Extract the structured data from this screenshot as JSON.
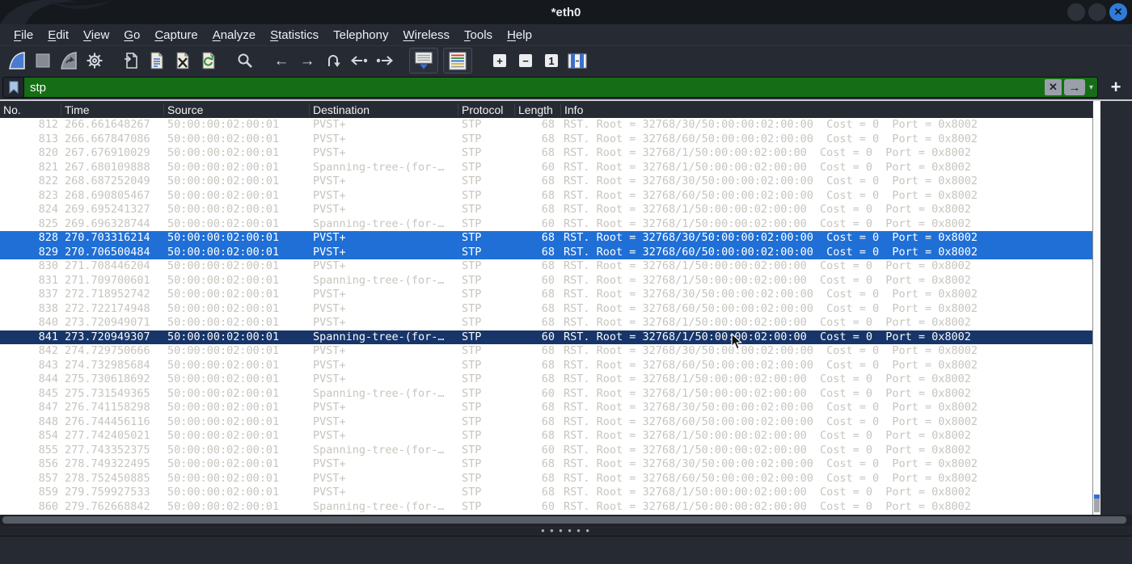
{
  "window": {
    "title": "*eth0",
    "controls": [
      "minimize",
      "maximize",
      "close"
    ],
    "close_glyph": "✕"
  },
  "menu_bar": {
    "items": [
      {
        "label": "File",
        "mnemonic": "F"
      },
      {
        "label": "Edit",
        "mnemonic": "E"
      },
      {
        "label": "View",
        "mnemonic": "V"
      },
      {
        "label": "Go",
        "mnemonic": "G"
      },
      {
        "label": "Capture",
        "mnemonic": "C"
      },
      {
        "label": "Analyze",
        "mnemonic": "A"
      },
      {
        "label": "Statistics",
        "mnemonic": "S"
      },
      {
        "label": "Telephony",
        "mnemonic": null
      },
      {
        "label": "Wireless",
        "mnemonic": "W"
      },
      {
        "label": "Tools",
        "mnemonic": "T"
      },
      {
        "label": "Help",
        "mnemonic": "H"
      }
    ]
  },
  "toolbar": {
    "buttons": [
      "start-capture",
      "stop-capture",
      "restart-capture",
      "capture-options",
      "open-file",
      "save-file",
      "close-file",
      "reload-file",
      "find-packet",
      "go-back",
      "go-forward",
      "go-to-packet",
      "go-first-packet",
      "go-last-packet",
      "auto-scroll-toggle",
      "colorize-toggle",
      "zoom-in",
      "zoom-out",
      "normal-size",
      "resize-columns"
    ]
  },
  "filter_bar": {
    "value": "stp",
    "clear_glyph": "✕",
    "apply_glyph": "→",
    "dropdown_glyph": "▾",
    "add_glyph": "+"
  },
  "packet_list": {
    "columns": [
      "No.",
      "Time",
      "Source",
      "Destination",
      "Protocol",
      "Length",
      "Info"
    ],
    "rows": [
      {
        "no": "812",
        "time": "266.661648267",
        "source": "50:00:00:02:00:01",
        "destination": "PVST+",
        "protocol": "STP",
        "length": "68",
        "info": "RST. Root = 32768/30/50:00:00:02:00:00  Cost = 0  Port = 0x8002",
        "selected": "none"
      },
      {
        "no": "813",
        "time": "266.667847086",
        "source": "50:00:00:02:00:01",
        "destination": "PVST+",
        "protocol": "STP",
        "length": "68",
        "info": "RST. Root = 32768/60/50:00:00:02:00:00  Cost = 0  Port = 0x8002",
        "selected": "none"
      },
      {
        "no": "820",
        "time": "267.676910029",
        "source": "50:00:00:02:00:01",
        "destination": "PVST+",
        "protocol": "STP",
        "length": "68",
        "info": "RST. Root = 32768/1/50:00:00:02:00:00  Cost = 0  Port = 0x8002",
        "selected": "none"
      },
      {
        "no": "821",
        "time": "267.680109888",
        "source": "50:00:00:02:00:01",
        "destination": "Spanning-tree-(for-…",
        "protocol": "STP",
        "length": "60",
        "info": "RST. Root = 32768/1/50:00:00:02:00:00  Cost = 0  Port = 0x8002",
        "selected": "none"
      },
      {
        "no": "822",
        "time": "268.687252049",
        "source": "50:00:00:02:00:01",
        "destination": "PVST+",
        "protocol": "STP",
        "length": "68",
        "info": "RST. Root = 32768/30/50:00:00:02:00:00  Cost = 0  Port = 0x8002",
        "selected": "none"
      },
      {
        "no": "823",
        "time": "268.690805467",
        "source": "50:00:00:02:00:01",
        "destination": "PVST+",
        "protocol": "STP",
        "length": "68",
        "info": "RST. Root = 32768/60/50:00:00:02:00:00  Cost = 0  Port = 0x8002",
        "selected": "none"
      },
      {
        "no": "824",
        "time": "269.695241327",
        "source": "50:00:00:02:00:01",
        "destination": "PVST+",
        "protocol": "STP",
        "length": "68",
        "info": "RST. Root = 32768/1/50:00:00:02:00:00  Cost = 0  Port = 0x8002",
        "selected": "none"
      },
      {
        "no": "825",
        "time": "269.696328744",
        "source": "50:00:00:02:00:01",
        "destination": "Spanning-tree-(for-…",
        "protocol": "STP",
        "length": "60",
        "info": "RST. Root = 32768/1/50:00:00:02:00:00  Cost = 0  Port = 0x8002",
        "selected": "none"
      },
      {
        "no": "828",
        "time": "270.703316214",
        "source": "50:00:00:02:00:01",
        "destination": "PVST+",
        "protocol": "STP",
        "length": "68",
        "info": "RST. Root = 32768/30/50:00:00:02:00:00  Cost = 0  Port = 0x8002",
        "selected": "light"
      },
      {
        "no": "829",
        "time": "270.706500484",
        "source": "50:00:00:02:00:01",
        "destination": "PVST+",
        "protocol": "STP",
        "length": "68",
        "info": "RST. Root = 32768/60/50:00:00:02:00:00  Cost = 0  Port = 0x8002",
        "selected": "light"
      },
      {
        "no": "830",
        "time": "271.708446204",
        "source": "50:00:00:02:00:01",
        "destination": "PVST+",
        "protocol": "STP",
        "length": "68",
        "info": "RST. Root = 32768/1/50:00:00:02:00:00  Cost = 0  Port = 0x8002",
        "selected": "none"
      },
      {
        "no": "831",
        "time": "271.709700601",
        "source": "50:00:00:02:00:01",
        "destination": "Spanning-tree-(for-…",
        "protocol": "STP",
        "length": "60",
        "info": "RST. Root = 32768/1/50:00:00:02:00:00  Cost = 0  Port = 0x8002",
        "selected": "none"
      },
      {
        "no": "837",
        "time": "272.718952742",
        "source": "50:00:00:02:00:01",
        "destination": "PVST+",
        "protocol": "STP",
        "length": "68",
        "info": "RST. Root = 32768/30/50:00:00:02:00:00  Cost = 0  Port = 0x8002",
        "selected": "none"
      },
      {
        "no": "838",
        "time": "272.722174948",
        "source": "50:00:00:02:00:01",
        "destination": "PVST+",
        "protocol": "STP",
        "length": "68",
        "info": "RST. Root = 32768/60/50:00:00:02:00:00  Cost = 0  Port = 0x8002",
        "selected": "none"
      },
      {
        "no": "840",
        "time": "273.720949071",
        "source": "50:00:00:02:00:01",
        "destination": "PVST+",
        "protocol": "STP",
        "length": "68",
        "info": "RST. Root = 32768/1/50:00:00:02:00:00  Cost = 0  Port = 0x8002",
        "selected": "none"
      },
      {
        "no": "841",
        "time": "273.720949307",
        "source": "50:00:00:02:00:01",
        "destination": "Spanning-tree-(for-…",
        "protocol": "STP",
        "length": "60",
        "info": "RST. Root = 32768/1/50:00:00:02:00:00  Cost = 0  Port = 0x8002",
        "selected": "dark"
      },
      {
        "no": "842",
        "time": "274.729750666",
        "source": "50:00:00:02:00:01",
        "destination": "PVST+",
        "protocol": "STP",
        "length": "68",
        "info": "RST. Root = 32768/30/50:00:00:02:00:00  Cost = 0  Port = 0x8002",
        "selected": "none"
      },
      {
        "no": "843",
        "time": "274.732985684",
        "source": "50:00:00:02:00:01",
        "destination": "PVST+",
        "protocol": "STP",
        "length": "68",
        "info": "RST. Root = 32768/60/50:00:00:02:00:00  Cost = 0  Port = 0x8002",
        "selected": "none"
      },
      {
        "no": "844",
        "time": "275.730618692",
        "source": "50:00:00:02:00:01",
        "destination": "PVST+",
        "protocol": "STP",
        "length": "68",
        "info": "RST. Root = 32768/1/50:00:00:02:00:00  Cost = 0  Port = 0x8002",
        "selected": "none"
      },
      {
        "no": "845",
        "time": "275.731549365",
        "source": "50:00:00:02:00:01",
        "destination": "Spanning-tree-(for-…",
        "protocol": "STP",
        "length": "60",
        "info": "RST. Root = 32768/1/50:00:00:02:00:00  Cost = 0  Port = 0x8002",
        "selected": "none"
      },
      {
        "no": "847",
        "time": "276.741158298",
        "source": "50:00:00:02:00:01",
        "destination": "PVST+",
        "protocol": "STP",
        "length": "68",
        "info": "RST. Root = 32768/30/50:00:00:02:00:00  Cost = 0  Port = 0x8002",
        "selected": "none"
      },
      {
        "no": "848",
        "time": "276.744456116",
        "source": "50:00:00:02:00:01",
        "destination": "PVST+",
        "protocol": "STP",
        "length": "68",
        "info": "RST. Root = 32768/60/50:00:00:02:00:00  Cost = 0  Port = 0x8002",
        "selected": "none"
      },
      {
        "no": "854",
        "time": "277.742405021",
        "source": "50:00:00:02:00:01",
        "destination": "PVST+",
        "protocol": "STP",
        "length": "68",
        "info": "RST. Root = 32768/1/50:00:00:02:00:00  Cost = 0  Port = 0x8002",
        "selected": "none"
      },
      {
        "no": "855",
        "time": "277.743352375",
        "source": "50:00:00:02:00:01",
        "destination": "Spanning-tree-(for-…",
        "protocol": "STP",
        "length": "60",
        "info": "RST. Root = 32768/1/50:00:00:02:00:00  Cost = 0  Port = 0x8002",
        "selected": "none"
      },
      {
        "no": "856",
        "time": "278.749322495",
        "source": "50:00:00:02:00:01",
        "destination": "PVST+",
        "protocol": "STP",
        "length": "68",
        "info": "RST. Root = 32768/30/50:00:00:02:00:00  Cost = 0  Port = 0x8002",
        "selected": "none"
      },
      {
        "no": "857",
        "time": "278.752450885",
        "source": "50:00:00:02:00:01",
        "destination": "PVST+",
        "protocol": "STP",
        "length": "68",
        "info": "RST. Root = 32768/60/50:00:00:02:00:00  Cost = 0  Port = 0x8002",
        "selected": "none"
      },
      {
        "no": "859",
        "time": "279.759927533",
        "source": "50:00:00:02:00:01",
        "destination": "PVST+",
        "protocol": "STP",
        "length": "68",
        "info": "RST. Root = 32768/1/50:00:00:02:00:00  Cost = 0  Port = 0x8002",
        "selected": "none"
      },
      {
        "no": "860",
        "time": "279.762668842",
        "source": "50:00:00:02:00:01",
        "destination": "Spanning-tree-(for-…",
        "protocol": "STP",
        "length": "60",
        "info": "RST. Root = 32768/1/50:00:00:02:00:00  Cost = 0  Port = 0x8002",
        "selected": "none"
      }
    ]
  },
  "colors": {
    "selection_light": "#1f6fd6",
    "selection_dark": "#173569",
    "filter_valid_bg": "#156e15",
    "row_text": "#c8c5be",
    "chrome_bg": "#262a33",
    "titlebar_bg": "#15181d"
  }
}
